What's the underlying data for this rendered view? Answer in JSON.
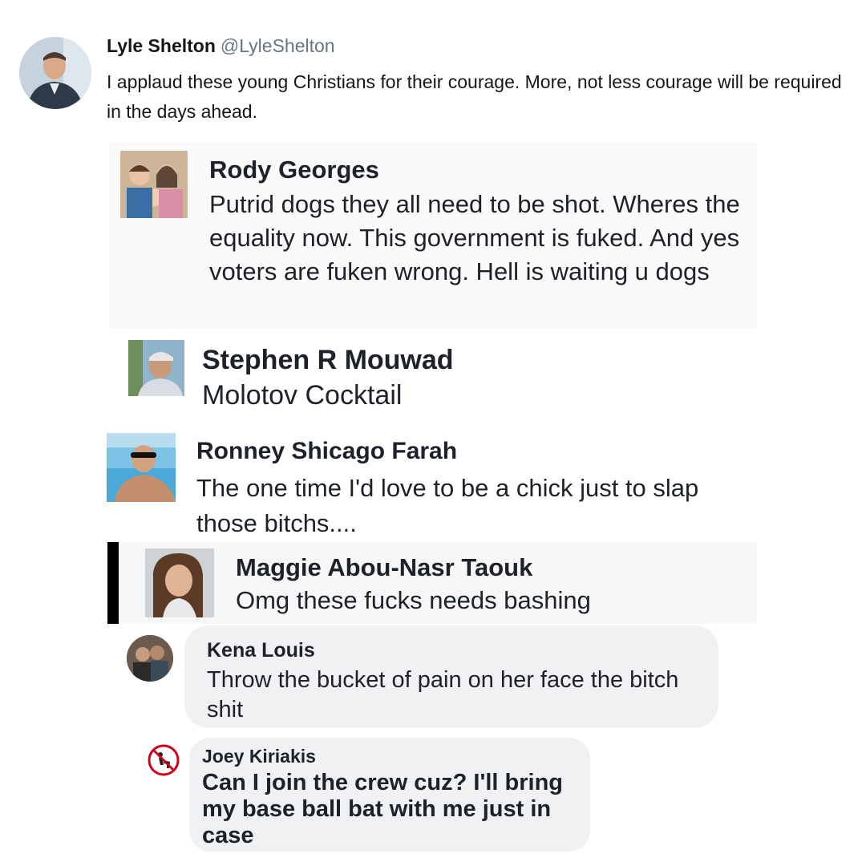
{
  "tweet": {
    "display_name": "Lyle Shelton",
    "handle": "@LyleShelton",
    "text": "I applaud these young Christians for their courage. More, not less courage will be required in the days ahead.",
    "avatar_icon": "profile-photo"
  },
  "comments": [
    {
      "name": "Rody Georges",
      "text": "Putrid dogs they all need to be shot. Wheres the equality now. This government is fuked. And yes voters are fuken wrong. Hell is waiting u dogs"
    },
    {
      "name": "Stephen R Mouwad",
      "text": "Molotov Cocktail"
    },
    {
      "name": "Ronney Shicago Farah",
      "text": "The one time I'd love to be a chick just to slap those bitchs...."
    },
    {
      "name": "Maggie Abou-Nasr Taouk",
      "text": "Omg these fucks needs bashing"
    },
    {
      "name": "Kena Louis",
      "text": "Throw the bucket of pain on her face the bitch shit"
    },
    {
      "name": "Joey Kiriakis",
      "text": "Can I join the crew cuz? I'll bring my base ball bat with me just in case"
    }
  ],
  "colors": {
    "tweet_handle": "#657786",
    "comment_text": "#1d2129",
    "bubble_bg": "#f1f1f3"
  }
}
